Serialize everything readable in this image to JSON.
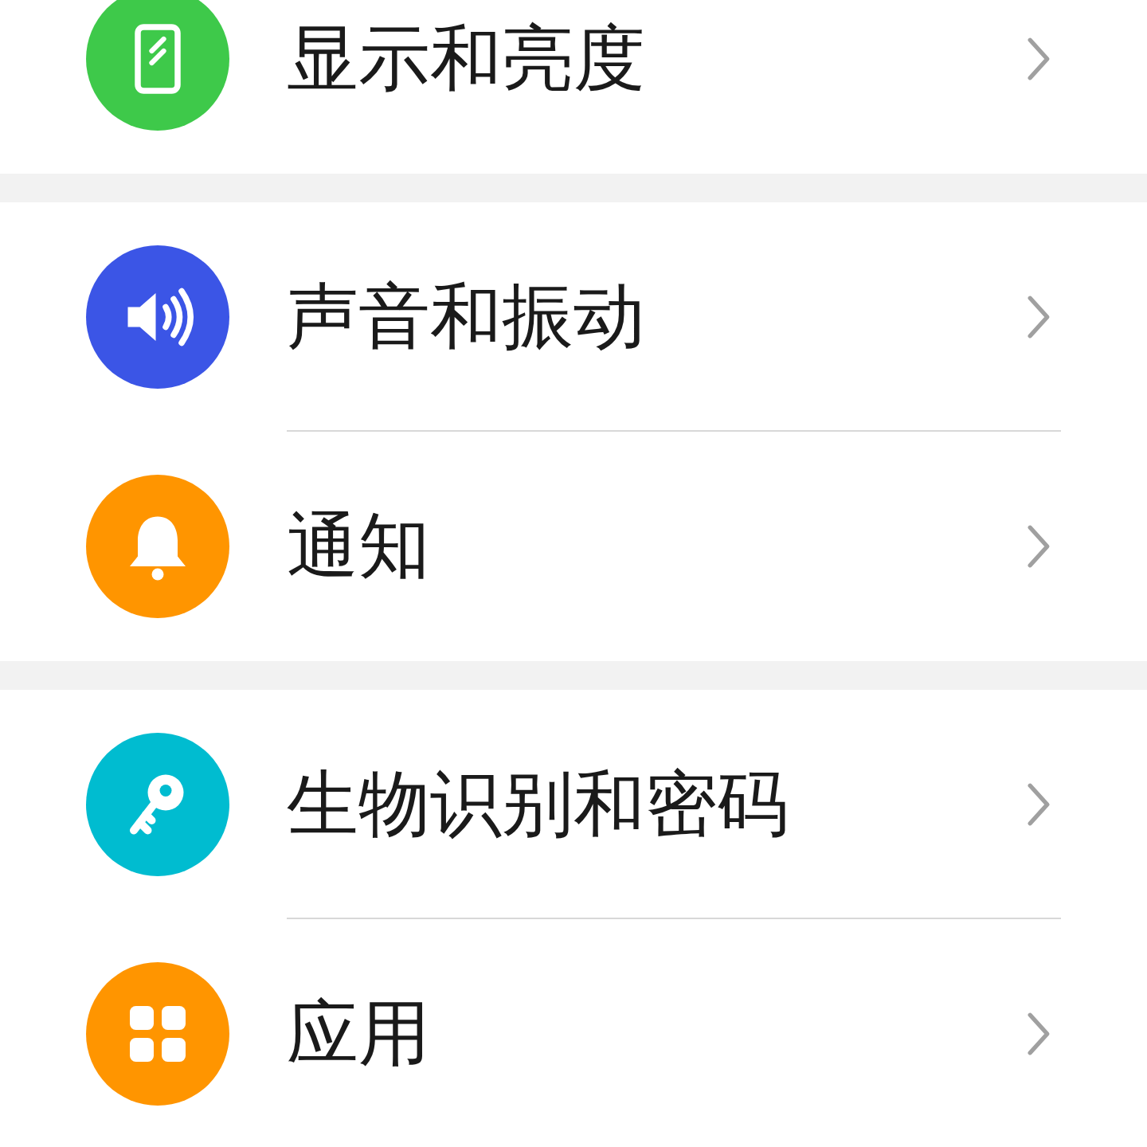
{
  "groups": [
    {
      "items": [
        {
          "label": "显示和亮度",
          "color": "#3ec94a"
        }
      ]
    },
    {
      "items": [
        {
          "label": "声音和振动",
          "color": "#3b55e6"
        },
        {
          "label": "通知",
          "color": "#ff9500"
        }
      ]
    },
    {
      "items": [
        {
          "label": "生物识别和密码",
          "color": "#00bcd0"
        },
        {
          "label": "应用",
          "color": "#ff9500"
        }
      ]
    }
  ]
}
